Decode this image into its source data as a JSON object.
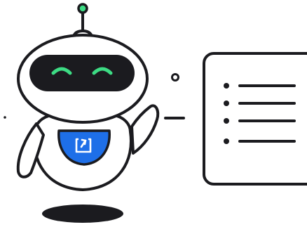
{
  "illustration": {
    "subject": "robot-with-document",
    "colors": {
      "outline": "#1b1b1f",
      "face_screen": "#1b1b1f",
      "eyes": "#3ddc84",
      "antenna_tip": "#3ddc84",
      "chest_plate": "#1e6fe8",
      "body": "#ffffff",
      "shadow": "#1b1b1f"
    },
    "icons": {
      "chest": "share-icon",
      "document": "list-document-icon"
    },
    "document_list_items": 4
  }
}
